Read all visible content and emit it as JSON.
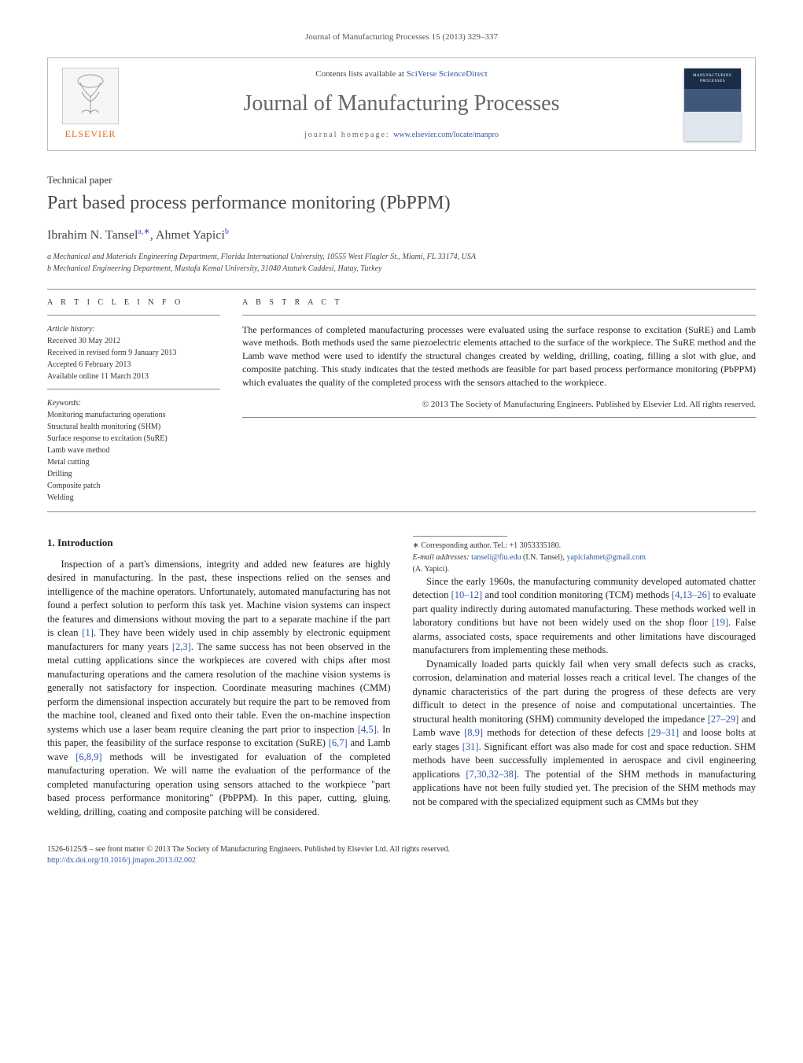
{
  "header": {
    "journal_ref": "Journal of Manufacturing Processes 15 (2013) 329–337",
    "contents_prefix": "Contents lists available at ",
    "contents_link": "SciVerse ScienceDirect",
    "journal_name": "Journal of Manufacturing Processes",
    "homepage_prefix": "journal homepage: ",
    "homepage_link": "www.elsevier.com/locate/manpro",
    "elsevier_label": "ELSEVIER",
    "cover_title": "MANUFACTURING PROCESSES"
  },
  "paper": {
    "type": "Technical paper",
    "title": "Part based process performance monitoring (PbPPM)",
    "authors_html": "Ibrahim N. Tansel",
    "author1": "Ibrahim N. Tansel",
    "author1_sup": "a,∗",
    "sep": ", ",
    "author2": "Ahmet Yapici",
    "author2_sup": "b",
    "affil_a": "a Mechanical and Materials Engineering Department, Florida International University, 10555 West Flagler St., Miami, FL 33174, USA",
    "affil_b": "b Mechanical Engineering Department, Mustafa Kemal University, 31040 Ataturk Caddesi, Hatay, Turkey"
  },
  "info": {
    "heading": "a r t i c l e   i n f o",
    "history_label": "Article history:",
    "received": "Received 30 May 2012",
    "revised": "Received in revised form 9 January 2013",
    "accepted": "Accepted 6 February 2013",
    "online": "Available online 11 March 2013",
    "keywords_label": "Keywords:",
    "keywords": [
      "Monitoring manufacturing operations",
      "Structural health monitoring (SHM)",
      "Surface response to excitation (SuRE)",
      "Lamb wave method",
      "Metal cutting",
      "Drilling",
      "Composite patch",
      "Welding"
    ]
  },
  "abstract": {
    "heading": "a b s t r a c t",
    "text": "The performances of completed manufacturing processes were evaluated using the surface response to excitation (SuRE) and Lamb wave methods. Both methods used the same piezoelectric elements attached to the surface of the workpiece. The SuRE method and the Lamb wave method were used to identify the structural changes created by welding, drilling, coating, filling a slot with glue, and composite patching. This study indicates that the tested methods are feasible for part based process performance monitoring (PbPPM) which evaluates the quality of the completed process with the sensors attached to the workpiece.",
    "copyright": "© 2013 The Society of Manufacturing Engineers. Published by Elsevier Ltd. All rights reserved."
  },
  "sections": {
    "intro_heading": "1. Introduction",
    "p1a": "Inspection of a part's dimensions, integrity and added new features are highly desired in manufacturing. In the past, these inspections relied on the senses and intelligence of the machine operators. Unfortunately, automated manufacturing has not found a perfect solution to perform this task yet. Machine vision systems can inspect the features and dimensions without moving the part to a separate machine if the part is clean ",
    "c1": "[1]",
    "p1b": ". They have been widely used in chip assembly by electronic equipment manufacturers for many years ",
    "c2": "[2,3]",
    "p1c": ". The same success has not been observed in the metal cutting applications since the workpieces are covered with chips after most manufacturing operations and the camera resolution of the machine vision systems is generally not satisfactory for inspection. Coordinate measuring machines (CMM) perform the dimensional inspection accurately but require the part to be removed from the machine tool, cleaned and fixed onto their table. Even the on-machine inspection systems which use a laser beam require cleaning the part prior to inspection ",
    "c3": "[4,5]",
    "p1d": ". In this paper, the feasibility of the surface response to excitation (SuRE) ",
    "c4": "[6,7]",
    "p1e": " and Lamb wave ",
    "c5": "[6,8,9]",
    "p1f": " methods will be investigated for evaluation of the completed manufacturing operation. We will name the evaluation of the performance of the completed manufacturing operation using sensors attached to the workpiece \"part based process performance monitoring\" (PbPPM). In this paper, cutting, gluing, welding, drilling, coating and composite patching will be considered.",
    "p2a": "Since the early 1960s, the manufacturing community developed automated chatter detection ",
    "c6": "[10–12]",
    "p2b": " and tool condition monitoring (TCM) methods ",
    "c7": "[4,13–26]",
    "p2c": " to evaluate part quality indirectly during automated manufacturing. These methods worked well in laboratory conditions but have not been widely used on the shop floor ",
    "c8": "[19]",
    "p2d": ". False alarms, associated costs, space requirements and other limitations have discouraged manufacturers from implementing these methods.",
    "p3a": "Dynamically loaded parts quickly fail when very small defects such as cracks, corrosion, delamination and material losses reach a critical level. The changes of the dynamic characteristics of the part during the progress of these defects are very difficult to detect in the presence of noise and computational uncertainties. The structural health monitoring (SHM) community developed the impedance ",
    "c9": "[27–29]",
    "p3b": " and Lamb wave ",
    "c10": "[8,9]",
    "p3c": " methods for detection of these defects ",
    "c11": "[29–31]",
    "p3d": " and loose bolts at early stages ",
    "c12": "[31]",
    "p3e": ". Significant effort was also made for cost and space reduction. SHM methods have been successfully implemented in aerospace and civil engineering applications ",
    "c13": "[7,30,32–38]",
    "p3f": ". The potential of the SHM methods in manufacturing applications have not been fully studied yet. The precision of the SHM methods may not be compared with the specialized equipment such as CMMs but they"
  },
  "footnote": {
    "corr": "∗ Corresponding author. Tel.: +1 3053335180.",
    "emails_label": "E-mail addresses: ",
    "email1": "tanseli@fiu.edu",
    "email1_who": " (I.N. Tansel), ",
    "email2": "yapiciahmet@gmail.com",
    "email2_who": " (A. Yapici)."
  },
  "bottom": {
    "front_matter": "1526-6125/$ – see front matter © 2013 The Society of Manufacturing Engineers. Published by Elsevier Ltd. All rights reserved.",
    "doi": "http://dx.doi.org/10.1016/j.jmapro.2013.02.002"
  }
}
